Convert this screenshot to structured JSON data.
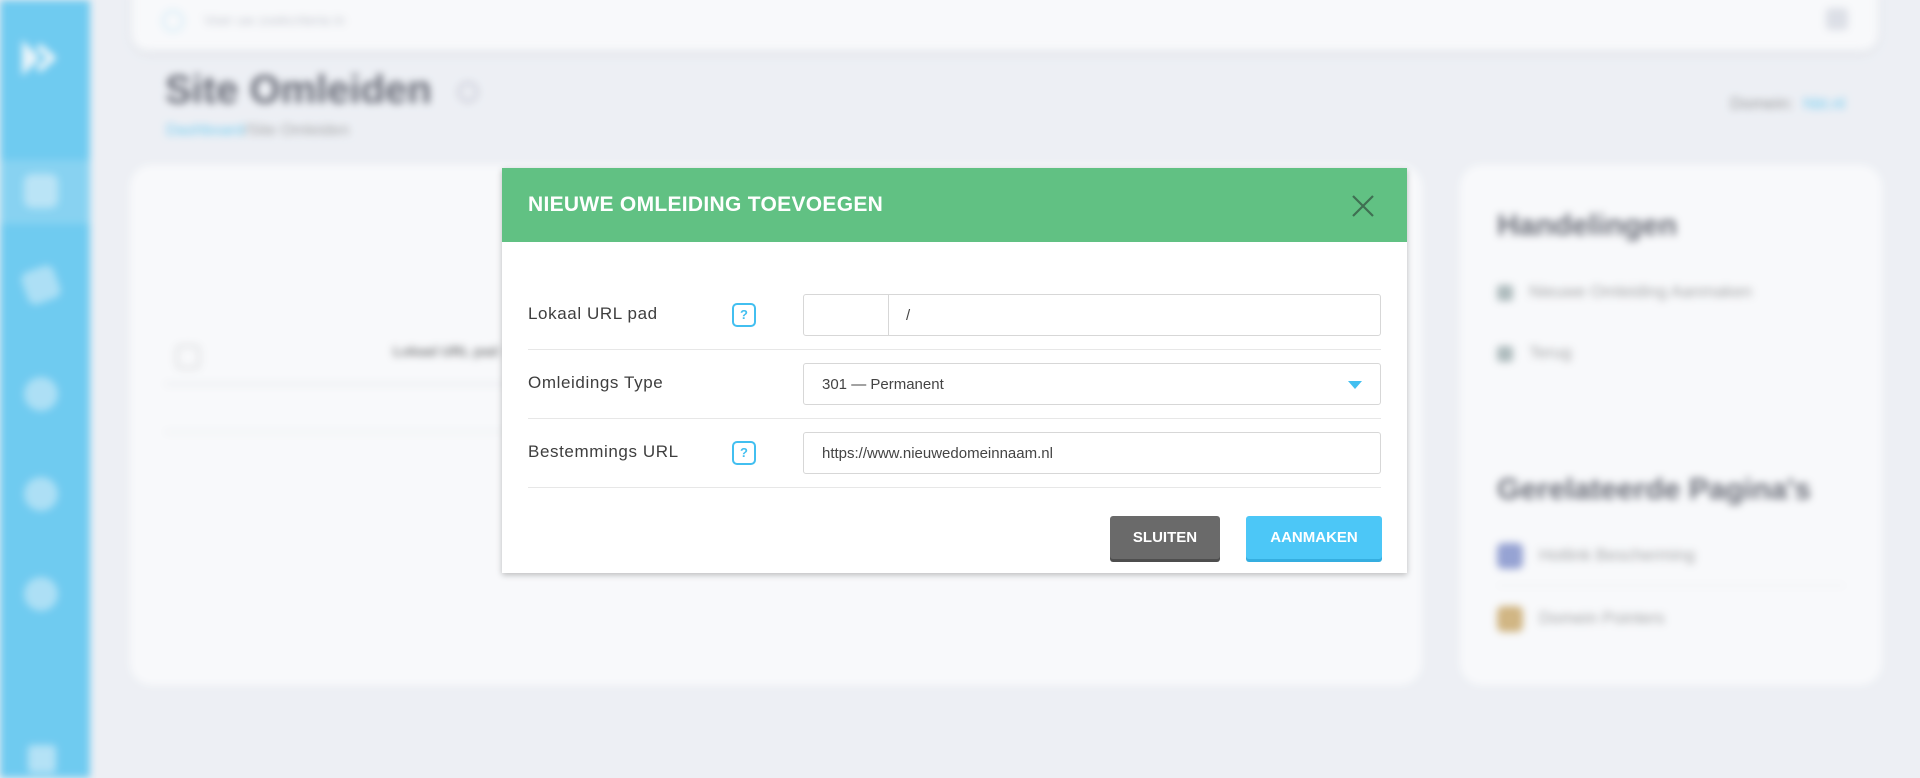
{
  "topbar": {
    "search_placeholder": "Voer uw zoekcriteria in"
  },
  "page": {
    "title": "Site Omleiden",
    "breadcrumb": {
      "home": "Dashboard",
      "separator": "/",
      "current": "Site Omleiden"
    },
    "domain_label": "Domein:",
    "domain_value": "hbt.nl"
  },
  "table": {
    "column_local_url": "Lokaal URL pad"
  },
  "side": {
    "actions_title": "Handelingen",
    "actions": [
      "Nieuwe Omleiding Aanmaken",
      "Terug"
    ],
    "related_title": "Gerelateerde Pagina's",
    "related": [
      "Hotlink Bescherming",
      "Domein Pointers"
    ]
  },
  "modal": {
    "title": "NIEUWE OMLEIDING TOEVOEGEN",
    "fields": {
      "local_path": {
        "label": "Lokaal URL pad",
        "prefix": "",
        "value": "/"
      },
      "type": {
        "label": "Omleidings Type",
        "value": "301 — Permanent"
      },
      "destination": {
        "label": "Bestemmings URL",
        "value": "https://www.nieuwedomeinnaam.nl"
      }
    },
    "help_glyph": "?",
    "buttons": {
      "close": "SLUITEN",
      "create": "AANMAKEN"
    }
  },
  "colors": {
    "sidebar": "#42bff0",
    "modal_header": "#61c183",
    "primary_button": "#4cc7f7",
    "secondary_button": "#6a6a6a"
  }
}
